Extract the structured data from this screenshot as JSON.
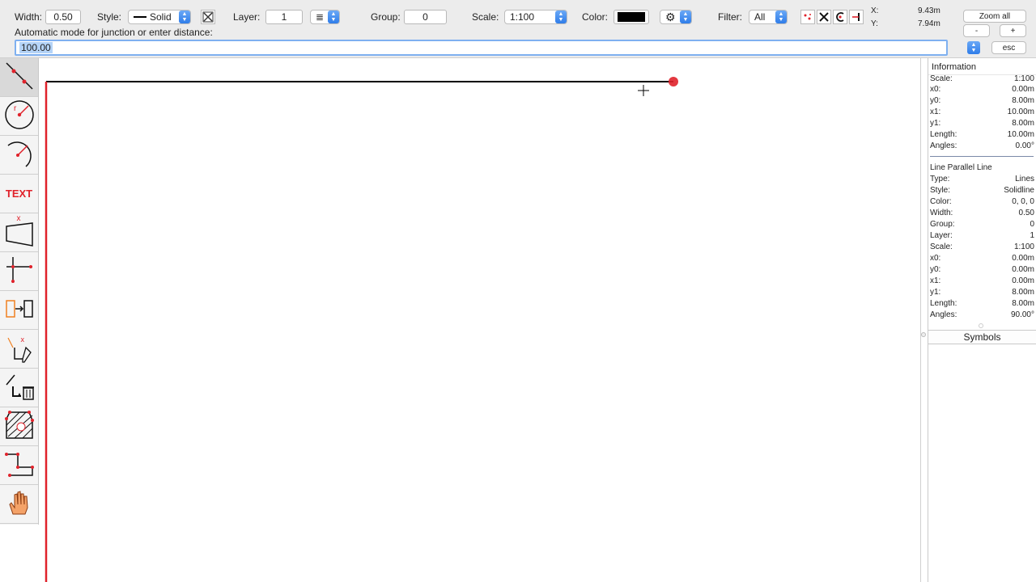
{
  "toolbar": {
    "width_label": "Width:",
    "width_value": "0.50",
    "style_label": "Style:",
    "style_value": "Solid",
    "layer_label": "Layer:",
    "layer_value": "1",
    "group_label": "Group:",
    "group_value": "0",
    "scale_label": "Scale:",
    "scale_value": "1:100",
    "color_label": "Color:",
    "color_value": "#000000",
    "filter_label": "Filter:",
    "filter_value": "All",
    "x_label": "X:",
    "x_value": "9.43m",
    "y_label": "Y:",
    "y_value": "7.94m",
    "zoom_all_label": "Zoom all",
    "zoom_out_label": "-",
    "zoom_in_label": "+",
    "esc_label": "esc",
    "prompt_label": "Automatic mode for junction or enter distance:",
    "distance_value": "100.00"
  },
  "tools": [
    {
      "name": "line-tool-icon",
      "active": true
    },
    {
      "name": "circle-tool-icon"
    },
    {
      "name": "arc-tool-icon"
    },
    {
      "name": "text-tool-icon",
      "label": "TEXT"
    },
    {
      "name": "dimension-tool-icon",
      "label": "x"
    },
    {
      "name": "perpendicular-tool-icon"
    },
    {
      "name": "copy-tool-icon"
    },
    {
      "name": "edit-tool-icon",
      "label": "x"
    },
    {
      "name": "delete-tool-icon"
    },
    {
      "name": "hatch-tool-icon"
    },
    {
      "name": "polyline-tool-icon"
    },
    {
      "name": "hand-tool-icon"
    }
  ],
  "info_panel": {
    "title": "Information",
    "first": [
      {
        "k": "Scale:",
        "v": "1:100"
      },
      {
        "k": "x0:",
        "v": "0.00m"
      },
      {
        "k": "y0:",
        "v": "8.00m"
      },
      {
        "k": "x1:",
        "v": "10.00m"
      },
      {
        "k": "y1:",
        "v": "8.00m"
      },
      {
        "k": "Length:",
        "v": "10.00m"
      },
      {
        "k": "Angles:",
        "v": "0.00°"
      }
    ],
    "second_title": "Line Parallel Line",
    "second": [
      {
        "k": "Type:",
        "v": "Lines"
      },
      {
        "k": "Style:",
        "v": "Solidline"
      },
      {
        "k": "Color:",
        "v": "0, 0, 0"
      },
      {
        "k": "Width:",
        "v": "0.50"
      },
      {
        "k": "Group:",
        "v": "0"
      },
      {
        "k": "Layer:",
        "v": "1"
      },
      {
        "k": "Scale:",
        "v": "1:100"
      },
      {
        "k": "x0:",
        "v": "0.00m"
      },
      {
        "k": "y0:",
        "v": "0.00m"
      },
      {
        "k": "x1:",
        "v": "0.00m"
      },
      {
        "k": "y1:",
        "v": "8.00m"
      },
      {
        "k": "Length:",
        "v": "8.00m"
      },
      {
        "k": "Angles:",
        "v": "90.00°"
      }
    ],
    "symbols_label": "Symbols"
  },
  "colors": {
    "accent": "#e0222b",
    "selection_blue": "#2f7de9",
    "line": "#000000"
  }
}
